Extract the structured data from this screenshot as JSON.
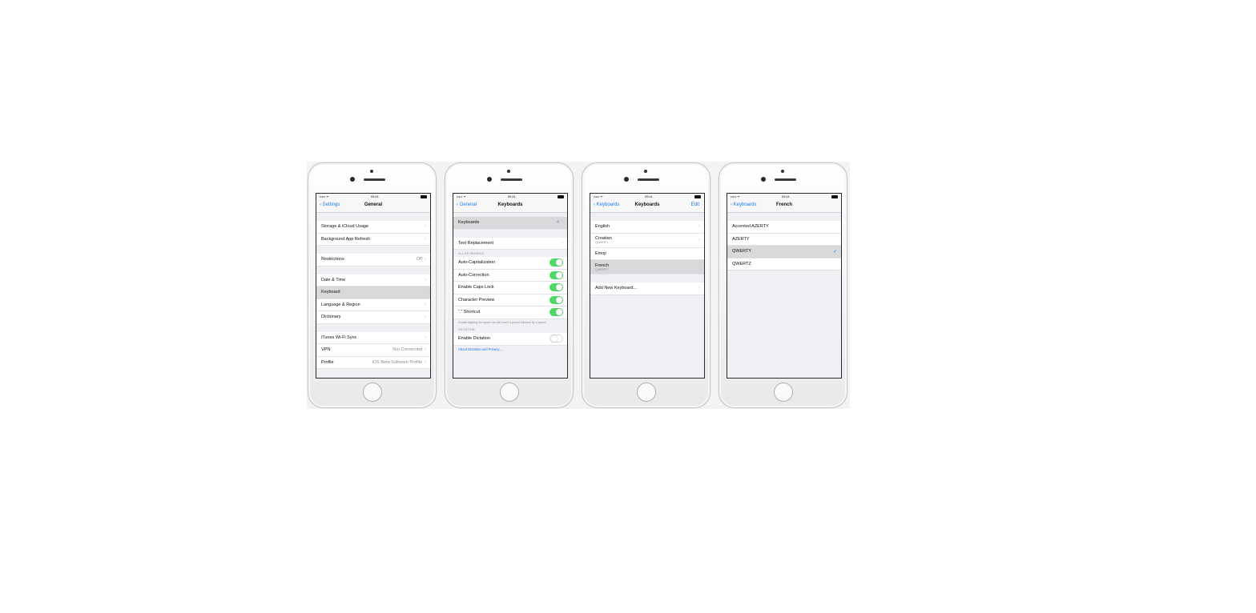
{
  "phones": [
    {
      "status": {
        "carrier": "••••• ᯤ",
        "time": "09:41"
      },
      "nav": {
        "back": "Settings",
        "title": "General"
      },
      "rows": {
        "storage": "Storage & iCloud Usage",
        "bg_refresh": "Background App Refresh",
        "restrictions": "Restrictions",
        "restrictions_value": "Off",
        "date_time": "Date & Time",
        "keyboard": "Keyboard",
        "language": "Language & Region",
        "dictionary": "Dictionary",
        "itunes": "iTunes Wi-Fi Sync",
        "vpn": "VPN",
        "vpn_value": "Not Connected",
        "profile": "Profile",
        "profile_value": "iOS Beta Software Profile"
      }
    },
    {
      "status": {
        "carrier": "••••• ᯤ",
        "time": "09:41"
      },
      "nav": {
        "back": "General",
        "title": "Keyboards"
      },
      "rows": {
        "keyboards": "Keyboards",
        "keyboards_value": "4",
        "text_replacement": "Text Replacement",
        "all_keyboards_header": "ALL KEYBOARDS",
        "auto_cap": "Auto-Capitalization",
        "auto_correct": "Auto-Correction",
        "caps_lock": "Enable Caps Lock",
        "char_preview": "Character Preview",
        "shortcut": "“.” Shortcut",
        "shortcut_footer": "Double tapping the space bar will insert a period followed by a space.",
        "dictation_header": "DICTATION",
        "dictation": "Enable Dictation",
        "privacy_link": "About Dictation and Privacy…"
      },
      "toggles": {
        "auto_cap": true,
        "auto_correct": true,
        "caps_lock": true,
        "char_preview": true,
        "shortcut": true,
        "dictation": false
      }
    },
    {
      "status": {
        "carrier": "••••• ᯤ",
        "time": "09:41"
      },
      "nav": {
        "back": "Keyboards",
        "title": "Keyboards",
        "right": "Edit"
      },
      "rows": {
        "english": "English",
        "croatian": "Croatian",
        "croatian_sub": "QWERTY",
        "emoji": "Emoji",
        "french": "French",
        "french_sub": "QWERTY",
        "add_new": "Add New Keyboard..."
      }
    },
    {
      "status": {
        "carrier": "••••• ᯤ",
        "time": "09:41"
      },
      "nav": {
        "back": "Keyboards",
        "title": "French"
      },
      "rows": {
        "accented": "Accented AZERTY",
        "azerty": "AZERTY",
        "qwerty": "QWERTY",
        "qwertz": "QWERTZ"
      },
      "selected": "QWERTY"
    }
  ],
  "colors": {
    "accent": "#1a7cf5",
    "toggle_on": "#4cd964",
    "selected_row": "#d9d9dc",
    "group_bg": "#efeff4"
  },
  "icons": {
    "back": "chevron-left-icon",
    "disclosure": "chevron-right-icon",
    "check": "checkmark-icon"
  }
}
